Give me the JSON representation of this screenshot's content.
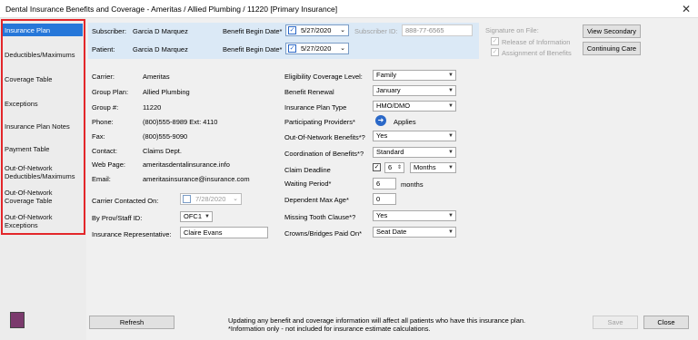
{
  "window": {
    "title": "Dental Insurance Benefits and Coverage - Ameritas / Allied Plumbing / 11220 [Primary Insurance]",
    "close": "✕"
  },
  "sidebar": {
    "items": [
      {
        "label": "Insurance Plan"
      },
      {
        "label": "Deductibles/Maximums"
      },
      {
        "label": "Coverage Table"
      },
      {
        "label": "Exceptions"
      },
      {
        "label": "Insurance Plan Notes"
      },
      {
        "label": "Payment Table"
      },
      {
        "label": "Out-Of-Network Deductibles/Maximums"
      },
      {
        "label": "Out-Of-Network Coverage Table"
      },
      {
        "label": "Out-Of-Network Exceptions"
      }
    ]
  },
  "header": {
    "subscriber_label": "Subscriber:",
    "subscriber_value": "Garcia D Marquez",
    "patient_label": "Patient:",
    "patient_value": "Garcia D Marquez",
    "benefit_begin_label": "Benefit Begin Date*",
    "sub_date": "5/27/2020",
    "pat_date": "5/27/2020",
    "subscriber_id_label": "Subscriber ID:",
    "subscriber_id": "888-77-6565",
    "signature_label": "Signature on File:",
    "release_label": "Release of Information",
    "assignment_label": "Assignment of Benefits",
    "view_secondary": "View Secondary",
    "continuing_care": "Continuing Care"
  },
  "carrier": {
    "carrier_label": "Carrier:",
    "carrier": "Ameritas",
    "group_plan_label": "Group Plan:",
    "group_plan": "Allied Plumbing",
    "group_num_label": "Group #:",
    "group_num": "11220",
    "phone_label": "Phone:",
    "phone": "(800)555-8989  Ext: 4110",
    "fax_label": "Fax:",
    "fax": "(800)555-9090",
    "contact_label": "Contact:",
    "contact": "Claims Dept.",
    "web_label": "Web Page:",
    "web": "ameritasdentalinsurance.info",
    "email_label": "Email:",
    "email": "ameritasinsurance@insurance.com",
    "contacted_label": "Carrier Contacted On:",
    "contacted_date": "7/28/2020",
    "prov_label": "By Prov/Staff ID:",
    "prov": "OFC1",
    "rep_label": "Insurance Representative:",
    "rep": "Claire Evans"
  },
  "plan": {
    "elig_label": "Eligibility Coverage Level:",
    "elig": "Family",
    "renewal_label": "Benefit Renewal",
    "renewal": "January",
    "type_label": "Insurance Plan Type",
    "type": "HMO/DMO",
    "participating_label": "Participating Providers*",
    "applies": "Applies",
    "oon_label": "Out-Of-Network Benefits*?",
    "oon": "Yes",
    "cob_label": "Coordination of Benefits*?",
    "cob": "Standard",
    "claim_label": "Claim Deadline",
    "claim_num": "6",
    "claim_unit": "Months",
    "waiting_label": "Waiting Period*",
    "waiting": "6",
    "waiting_unit": "months",
    "dep_label": "Dependent Max Age*",
    "dep": "0",
    "missing_label": "Missing Tooth Clause*?",
    "missing": "Yes",
    "crowns_label": "Crowns/Bridges Paid On*",
    "crowns": "Seat Date"
  },
  "footer": {
    "refresh": "Refresh",
    "note1": "Updating any benefit and coverage information will affect all patients who have this insurance plan.",
    "note2": "*Information only - not included for insurance estimate calculations.",
    "save": "Save",
    "close": "Close"
  }
}
